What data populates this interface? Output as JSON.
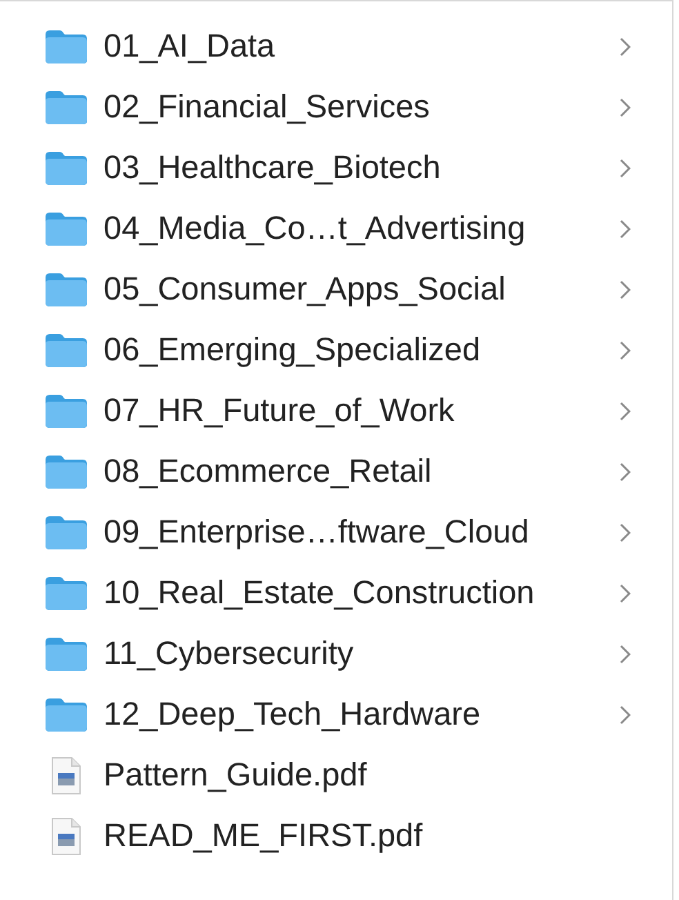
{
  "items": [
    {
      "kind": "folder",
      "name": "01_AI_Data"
    },
    {
      "kind": "folder",
      "name": "02_Financial_Services"
    },
    {
      "kind": "folder",
      "name": "03_Healthcare_Biotech"
    },
    {
      "kind": "folder",
      "name": "04_Media_Co…t_Advertising"
    },
    {
      "kind": "folder",
      "name": "05_Consumer_Apps_Social"
    },
    {
      "kind": "folder",
      "name": "06_Emerging_Specialized"
    },
    {
      "kind": "folder",
      "name": "07_HR_Future_of_Work"
    },
    {
      "kind": "folder",
      "name": "08_Ecommerce_Retail"
    },
    {
      "kind": "folder",
      "name": "09_Enterprise…ftware_Cloud"
    },
    {
      "kind": "folder",
      "name": "10_Real_Estate_Construction"
    },
    {
      "kind": "folder",
      "name": "11_Cybersecurity"
    },
    {
      "kind": "folder",
      "name": "12_Deep_Tech_Hardware"
    },
    {
      "kind": "pdf",
      "name": "Pattern_Guide.pdf"
    },
    {
      "kind": "pdf",
      "name": "READ_ME_FIRST.pdf"
    }
  ]
}
